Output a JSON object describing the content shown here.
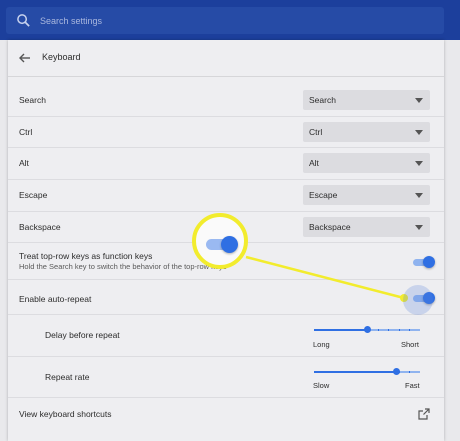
{
  "search": {
    "placeholder": "Search settings"
  },
  "header": {
    "title": "Keyboard"
  },
  "key_remaps": [
    {
      "label": "Search",
      "value": "Search"
    },
    {
      "label": "Ctrl",
      "value": "Ctrl"
    },
    {
      "label": "Alt",
      "value": "Alt"
    },
    {
      "label": "Escape",
      "value": "Escape"
    },
    {
      "label": "Backspace",
      "value": "Backspace"
    }
  ],
  "function_keys": {
    "label": "Treat top-row keys as function keys",
    "description": "Hold the Search key to switch the behavior of the top-row keys",
    "enabled": true
  },
  "auto_repeat": {
    "label": "Enable auto-repeat",
    "enabled": true
  },
  "delay": {
    "label": "Delay before repeat",
    "min_label": "Long",
    "max_label": "Short",
    "value_fraction": 0.5
  },
  "rate": {
    "label": "Repeat rate",
    "min_label": "Slow",
    "max_label": "Fast",
    "value_fraction": 0.77
  },
  "shortcuts": {
    "label": "View keyboard shortcuts"
  },
  "colors": {
    "accent": "#2f6fe3",
    "topbar": "#1c3f9c",
    "highlight": "#f2ec2d"
  },
  "icons": {
    "search": "search-icon",
    "back": "arrow-left-icon",
    "dropdown": "caret-down-icon",
    "external": "open-in-new-icon"
  }
}
